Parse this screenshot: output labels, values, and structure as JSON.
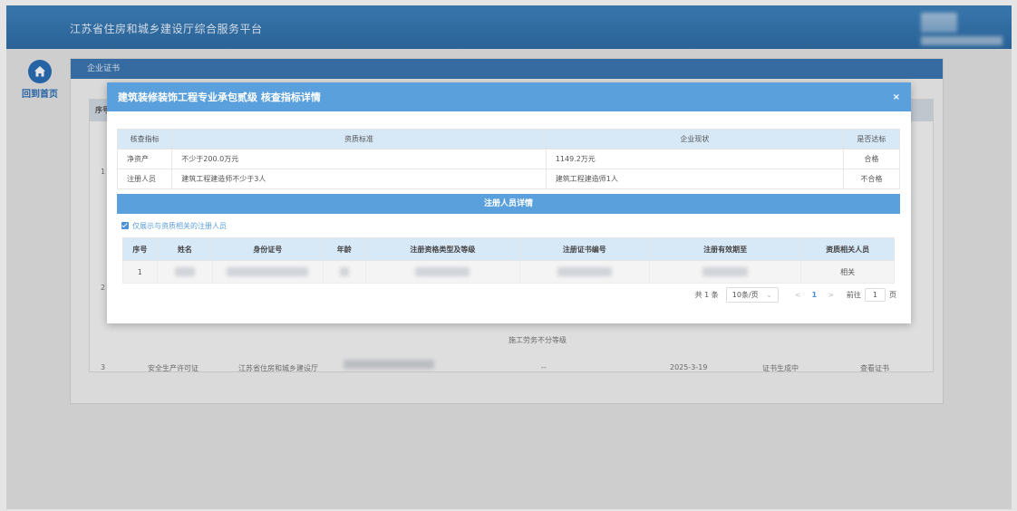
{
  "header": {
    "title": "江苏省住房和城乡建设厅综合服务平台"
  },
  "sidebar": {
    "home_label": "回到首页"
  },
  "panel": {
    "title": "企业证书",
    "col_index": "序号"
  },
  "background_rows": [
    {
      "index": "1"
    },
    {
      "index": "2"
    },
    {
      "index": "3",
      "cert_type": "安全生产许可证",
      "issuer": "江苏省住房和城乡建设厅",
      "level": "--",
      "expire": "2025-3-19",
      "status": "证书生成中",
      "action": "查看证书"
    }
  ],
  "background_note": "施工劳务不分等级",
  "modal": {
    "title": "建筑装修装饰工程专业承包贰级 核查指标详情",
    "close_label": "×",
    "index_table": {
      "headers": [
        "核查指标",
        "资质标准",
        "企业现状",
        "是否达标"
      ],
      "rows": [
        {
          "indicator": "净资产",
          "standard": "不少于200.0万元",
          "current": "1149.2万元",
          "result": "合格"
        },
        {
          "indicator": "注册人员",
          "standard": "建筑工程建造师不少于3人",
          "current": "建筑工程建造师1人",
          "result": "不合格"
        }
      ]
    },
    "registered_section_title": "注册人员详情",
    "filter_checkbox_label": "仅展示与资质相关的注册人员",
    "registered_table": {
      "headers": [
        "序号",
        "姓名",
        "身份证号",
        "年龄",
        "注册资格类型及等级",
        "注册证书编号",
        "注册有效期至",
        "资质相关人员"
      ],
      "rows": [
        {
          "index": "1",
          "related": "相关"
        }
      ]
    },
    "pagination": {
      "total": "共 1 条",
      "page_size": "10条/页",
      "current_page": "1",
      "goto_label": "前往",
      "goto_value": "1",
      "page_unit": "页"
    }
  },
  "colors": {
    "header": "#3479b4",
    "modal_header": "#5aa0dc",
    "fail": "#e0322a",
    "accent": "#4a90d9"
  }
}
